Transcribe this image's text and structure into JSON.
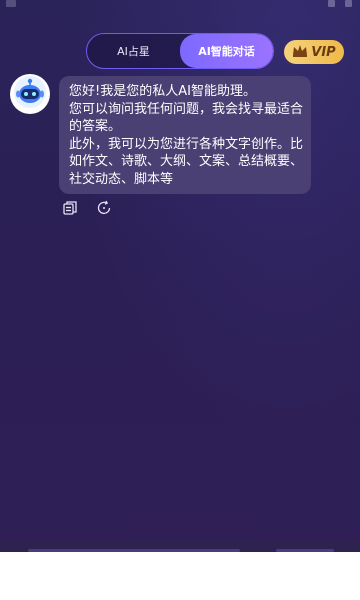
{
  "tabs": [
    {
      "label": "AI占星",
      "active": false
    },
    {
      "label": "AI智能对话",
      "active": true
    }
  ],
  "vip": {
    "label": "VIP",
    "icon": "crown-icon",
    "color": "#f0b94b"
  },
  "assistant": {
    "avatar_icon": "robot-icon",
    "message": "您好!我是您的私人AI智能助理。\n 您可以询问我任何问题，我会找寻最适合的答案。\n 此外，我可以为您进行各种文字创作。比如作文、诗歌、大纲、文案、总结概要、社交动态、脚本等"
  },
  "message_actions": [
    {
      "icon": "copy-icon"
    },
    {
      "icon": "regenerate-icon"
    }
  ],
  "colors": {
    "accent": "#7d69ff",
    "bubble": "#4b4074",
    "background": "#2b1f55"
  }
}
